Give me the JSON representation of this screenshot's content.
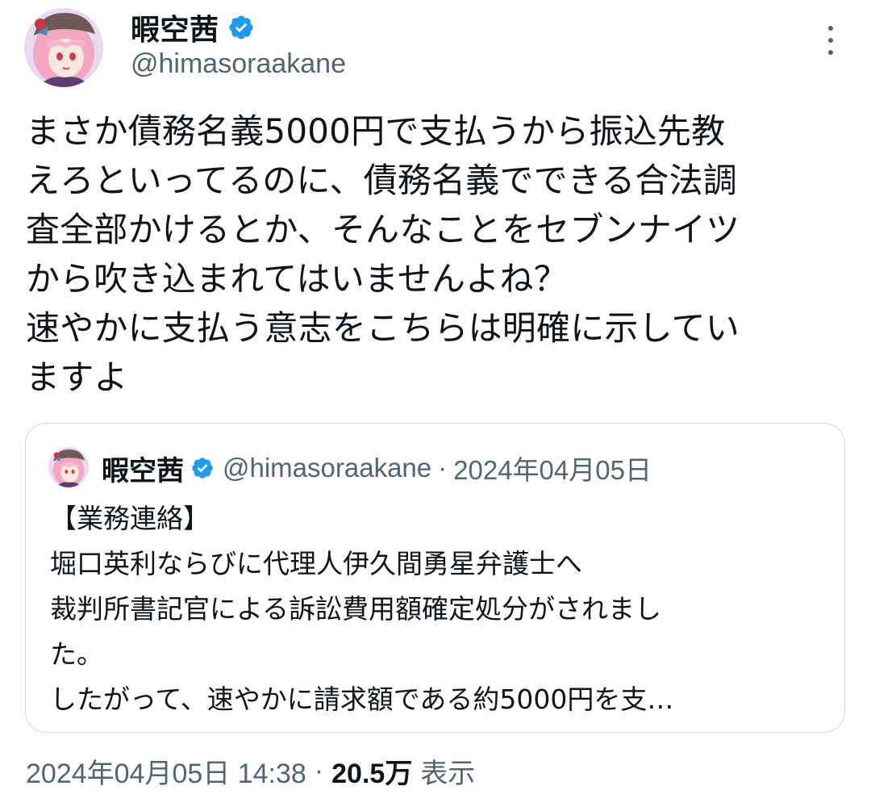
{
  "author": {
    "display_name": "暇空茜",
    "handle": "@himasoraakane",
    "verified": true,
    "avatar_icon": "anime-avatar",
    "verified_icon": "verified-badge-icon"
  },
  "more_icon": "more-options-icon",
  "tweet": {
    "lines": [
      "まさか債務名義5000円で支払うから振込先教",
      "えろといってるのに、債務名義でできる合法調",
      "査全部かけるとか、そんなことをセブンナイツ",
      "から吹き込まれてはいませんよね？",
      "速やかに支払う意志をこちらは明確に示してい",
      "ますよ"
    ]
  },
  "quote": {
    "display_name": "暇空茜",
    "handle": "@himasoraakane",
    "separator": "·",
    "date": "2024年04月05日",
    "lines": [
      "【業務連絡】",
      "堀口英利ならびに代理人伊久間勇星弁護士へ",
      "裁判所書記官による訴訟費用額確定処分がされまし",
      "た。",
      "したがって、速やかに請求額である約5000円を支…"
    ]
  },
  "meta": {
    "timestamp": "2024年04月05日 14:38",
    "separator": "·",
    "views_count": "20.5万",
    "views_label": "表示"
  },
  "colors": {
    "text": "#0f1419",
    "secondary": "#536471",
    "verified": "#1d9bf0",
    "border": "#cfd9de"
  }
}
